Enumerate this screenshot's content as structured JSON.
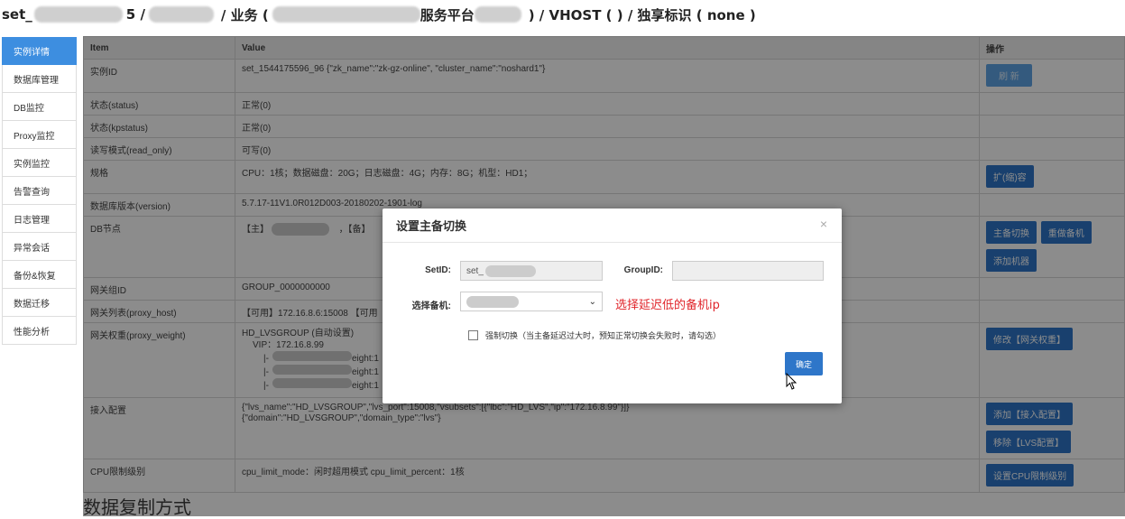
{
  "header": {
    "prefix": "set_",
    "sep1": "5 /",
    "sep2": "/ 业务 (",
    "platform": "服务平台",
    "tail": ") / VHOST ( ) / 独享标识 ( none )"
  },
  "sidebar": {
    "items": [
      "实例详情",
      "数据库管理",
      "DB监控",
      "Proxy监控",
      "实例监控",
      "告警查询",
      "日志管理",
      "异常会话",
      "备份&恢复",
      "数据迁移",
      "性能分析"
    ]
  },
  "table": {
    "headers": {
      "item": "Item",
      "value": "Value",
      "ops": "操作"
    },
    "rows": [
      {
        "item": "实例ID",
        "value": "set_1544175596_96 {\"zk_name\":\"zk-gz-online\", \"cluster_name\":\"noshard1\"}",
        "buttons": [
          "刷 新"
        ]
      },
      {
        "item": "状态(status)",
        "value": "正常(0)",
        "buttons": []
      },
      {
        "item": "状态(kpstatus)",
        "value": "正常(0)",
        "buttons": []
      },
      {
        "item": "读写模式(read_only)",
        "value": "可写(0)",
        "buttons": []
      },
      {
        "item": "规格",
        "value": "CPU：1核；数据磁盘：20G；日志磁盘：4G；内存：8G；机型：HD1；",
        "buttons": [
          "扩(缩)容"
        ]
      },
      {
        "item": "数据库版本(version)",
        "value": "5.7.17-11V1.0R012D003-20180202-1901-log",
        "buttons": []
      },
      {
        "item": "DB节点",
        "value": "【主】",
        "value2": "，【备】",
        "buttons": [
          "主备切换",
          "重做备机",
          "添加机器"
        ]
      },
      {
        "item": "网关组ID",
        "value": "GROUP_0000000000",
        "buttons": []
      },
      {
        "item": "网关列表(proxy_host)",
        "value": "【可用】172.16.8.6:15008 【可用",
        "buttons": []
      },
      {
        "item": "网关权重(proxy_weight)",
        "value": "HD_LVSGROUP (自动设置)",
        "value_lines": [
          "VIP：172.16.8.99",
          "|-",
          "|-",
          "|-"
        ],
        "weight_frags": [
          "eight:1",
          "eight:1",
          "eight:1"
        ],
        "buttons": [
          "修改【网关权重】"
        ]
      },
      {
        "item": "接入配置",
        "value": "{\"lvs_name\":\"HD_LVSGROUP\",\"lvs_port\":15008,\"vsubsets\":[{\"lbc\":\"HD_LVS\",\"ip\":\"172.16.8.99\"}]}",
        "value2": "{\"domain\":\"HD_LVSGROUP\",\"domain_type\":\"lvs\"}",
        "buttons": [
          "添加【接入配置】",
          "移除【LVS配置】"
        ]
      },
      {
        "item": "CPU限制级别",
        "value": "cpu_limit_mode：闲时超用模式  cpu_limit_percent：1核",
        "buttons": [
          "设置CPU限制级别"
        ]
      }
    ]
  },
  "section_title": "数据复制方式",
  "modal": {
    "title": "设置主备切换",
    "close": "×",
    "setid_label": "SetID:",
    "setid_value": "set_",
    "groupid_label": "GroupID:",
    "groupid_value": "",
    "backup_label": "选择备机:",
    "hint": "选择延迟低的备机ip",
    "force_label": "强制切换（当主备延迟过大时，预知正常切换会失败时，请勾选）",
    "ok_label": "确定"
  }
}
